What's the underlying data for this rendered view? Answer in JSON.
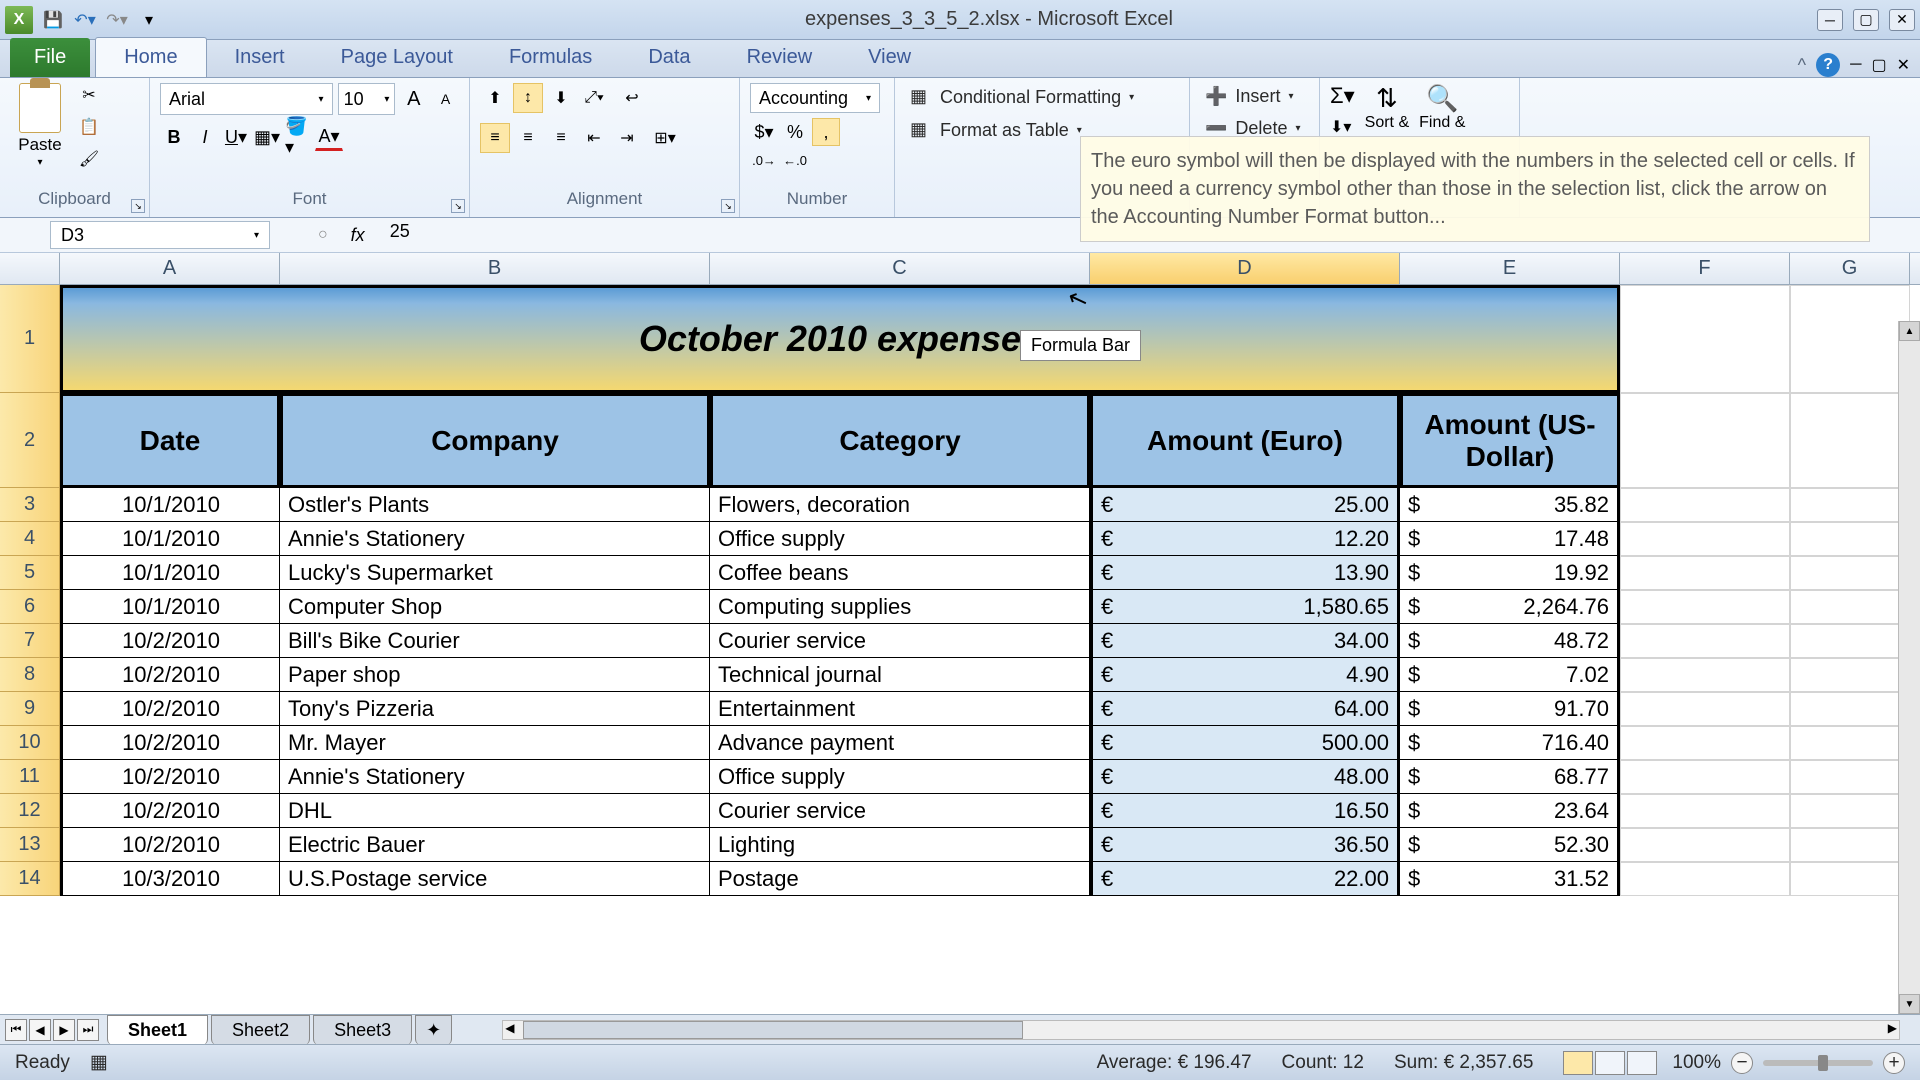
{
  "title_bar": {
    "filename": "expenses_3_3_5_2.xlsx",
    "app_name": "Microsoft Excel"
  },
  "tabs": {
    "file": "File",
    "home": "Home",
    "insert": "Insert",
    "page_layout": "Page Layout",
    "formulas": "Formulas",
    "data": "Data",
    "review": "Review",
    "view": "View"
  },
  "ribbon": {
    "clipboard": {
      "label": "Clipboard",
      "paste": "Paste"
    },
    "font": {
      "label": "Font",
      "name": "Arial",
      "size": "10"
    },
    "alignment": {
      "label": "Alignment"
    },
    "number": {
      "label": "Number",
      "format": "Accounting"
    },
    "styles": {
      "conditional": "Conditional Formatting",
      "table": "Format as Table"
    },
    "cells": {
      "insert": "Insert",
      "delete": "Delete"
    },
    "editing": {
      "sort": "Sort &",
      "find": "Find &"
    }
  },
  "tooltip_text": "The euro symbol will then be displayed with the numbers in the selected cell or cells. If you need a currency symbol other than those in the selection list, click the arrow on the Accounting Number Format button...",
  "name_box": "D3",
  "formula_value": "25",
  "formula_bar_label": "Formula Bar",
  "columns": [
    "A",
    "B",
    "C",
    "D",
    "E",
    "F",
    "G"
  ],
  "sheet_title": "October 2010 expenses",
  "headers": {
    "date": "Date",
    "company": "Company",
    "category": "Category",
    "euro": "Amount (Euro)",
    "dollar": "Amount (US-Dollar)"
  },
  "rows": [
    {
      "n": "3",
      "date": "10/1/2010",
      "company": "Ostler's Plants",
      "category": "Flowers, decoration",
      "euro": "25.00",
      "dollar": "35.82"
    },
    {
      "n": "4",
      "date": "10/1/2010",
      "company": "Annie's Stationery",
      "category": "Office supply",
      "euro": "12.20",
      "dollar": "17.48"
    },
    {
      "n": "5",
      "date": "10/1/2010",
      "company": "Lucky's Supermarket",
      "category": "Coffee beans",
      "euro": "13.90",
      "dollar": "19.92"
    },
    {
      "n": "6",
      "date": "10/1/2010",
      "company": "Computer Shop",
      "category": "Computing supplies",
      "euro": "1,580.65",
      "dollar": "2,264.76"
    },
    {
      "n": "7",
      "date": "10/2/2010",
      "company": "Bill's Bike Courier",
      "category": "Courier service",
      "euro": "34.00",
      "dollar": "48.72"
    },
    {
      "n": "8",
      "date": "10/2/2010",
      "company": "Paper shop",
      "category": "Technical journal",
      "euro": "4.90",
      "dollar": "7.02"
    },
    {
      "n": "9",
      "date": "10/2/2010",
      "company": "Tony's Pizzeria",
      "category": "Entertainment",
      "euro": "64.00",
      "dollar": "91.70"
    },
    {
      "n": "10",
      "date": "10/2/2010",
      "company": "Mr. Mayer",
      "category": "Advance payment",
      "euro": "500.00",
      "dollar": "716.40"
    },
    {
      "n": "11",
      "date": "10/2/2010",
      "company": "Annie's Stationery",
      "category": "Office supply",
      "euro": "48.00",
      "dollar": "68.77"
    },
    {
      "n": "12",
      "date": "10/2/2010",
      "company": "DHL",
      "category": "Courier service",
      "euro": "16.50",
      "dollar": "23.64"
    },
    {
      "n": "13",
      "date": "10/2/2010",
      "company": "Electric Bauer",
      "category": "Lighting",
      "euro": "36.50",
      "dollar": "52.30"
    },
    {
      "n": "14",
      "date": "10/3/2010",
      "company": "U.S.Postage service",
      "category": "Postage",
      "euro": "22.00",
      "dollar": "31.52"
    }
  ],
  "sheets": {
    "s1": "Sheet1",
    "s2": "Sheet2",
    "s3": "Sheet3"
  },
  "status": {
    "ready": "Ready",
    "average": "Average:  € 196.47",
    "count": "Count: 12",
    "sum": "Sum:  € 2,357.65",
    "zoom": "100%"
  }
}
